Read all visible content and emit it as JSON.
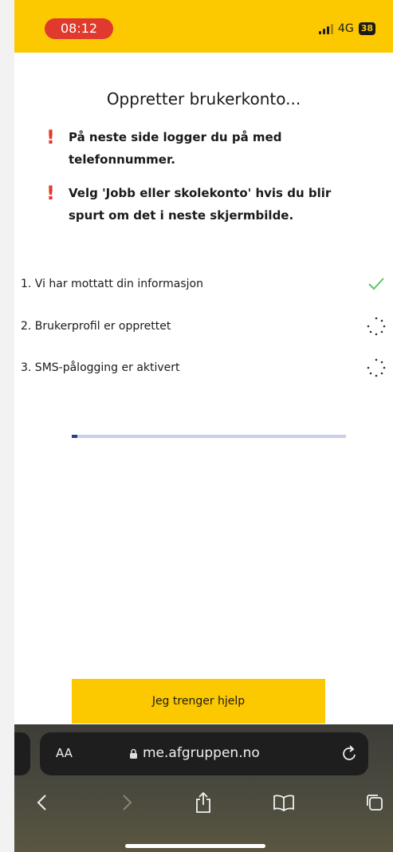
{
  "status_bar": {
    "time": "08:12",
    "network": "4G",
    "battery": "38"
  },
  "page": {
    "title": "Oppretter brukerkonto...",
    "notices": [
      {
        "icon": "exclamation-icon",
        "text_line1": "På neste side logger du på med",
        "text_line2": "telefonnummer."
      },
      {
        "icon": "exclamation-icon",
        "text_line1": "Velg 'Jobb eller skolekonto' hvis du blir",
        "text_line2": "spurt om det i neste skjermbilde."
      }
    ],
    "steps": [
      {
        "label": "1. Vi har mottatt din informasjon",
        "status": "done"
      },
      {
        "label": "2. Brukerprofil er opprettet",
        "status": "loading"
      },
      {
        "label": "3. SMS-pålogging er aktivert",
        "status": "loading"
      }
    ],
    "progress": 0.02,
    "help_button": "Jeg trenger hjelp"
  },
  "browser": {
    "text_size_label": "AA",
    "url": "me.afgruppen.no"
  },
  "colors": {
    "brand_yellow": "#fcc800",
    "alert_red": "#e03a2e",
    "check_green": "#5cc56e",
    "progress_fill": "#2b3f8f",
    "progress_track": "#c8cfe8"
  }
}
